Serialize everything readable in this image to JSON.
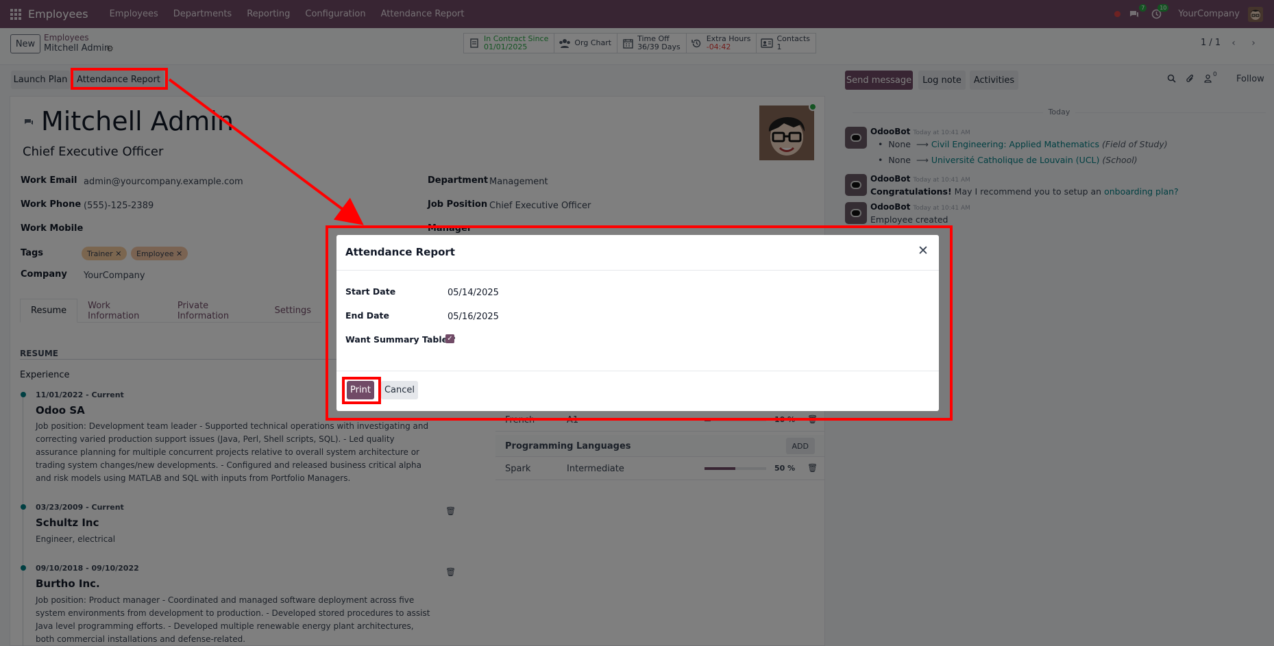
{
  "navbar": {
    "brand": "Employees",
    "menu": [
      "Employees",
      "Departments",
      "Reporting",
      "Configuration",
      "Attendance Report"
    ],
    "messages_badge": "7",
    "activities_badge": "10",
    "company": "YourCompany",
    "accent": "#714b67"
  },
  "control_panel": {
    "new_label": "New",
    "breadcrumb_parent": "Employees",
    "breadcrumb_current": "Mitchell Admin",
    "stats": [
      {
        "icon": "contract-icon",
        "line1": "In Contract Since",
        "line2": "01/01/2025"
      },
      {
        "icon": "org-chart-icon",
        "line1": "Org Chart",
        "line2": ""
      },
      {
        "icon": "calendar-icon",
        "line1": "Time Off",
        "line2": "36/39 Days"
      },
      {
        "icon": "history-icon",
        "line1": "Extra Hours",
        "line2": "-04:42"
      },
      {
        "icon": "contacts-icon",
        "line1": "Contacts",
        "line2": "1"
      }
    ],
    "pager": "1 / 1"
  },
  "actions": {
    "launch_plan": "Launch Plan",
    "attendance_report": "Attendance Report"
  },
  "employee": {
    "name": "Mitchell Admin",
    "job_title": "Chief Executive Officer",
    "fields_left": [
      {
        "label": "Work Email",
        "value": "admin@yourcompany.example.com"
      },
      {
        "label": "Work Phone",
        "value": "(555)-125-2389"
      },
      {
        "label": "Work Mobile",
        "value": ""
      },
      {
        "label": "Tags",
        "value": ""
      },
      {
        "label": "Company",
        "value": "YourCompany"
      }
    ],
    "fields_right": [
      {
        "label": "Department",
        "value": "Management"
      },
      {
        "label": "Job Position",
        "value": "Chief Executive Officer"
      },
      {
        "label": "Manager",
        "value": ""
      }
    ],
    "tags": [
      {
        "label": "Trainer",
        "color": "#f7cd9f"
      },
      {
        "label": "Employee",
        "color": "#f5c6a5"
      }
    ]
  },
  "tabs": [
    "Resume",
    "Work Information",
    "Private Information",
    "Settings"
  ],
  "resume": {
    "section": "RESUME",
    "subsection": "Experience",
    "entries": [
      {
        "date": "11/01/2022 - Current",
        "title": "Odoo SA",
        "desc": "Job position: Development team leader - Supported technical operations with investigating and correcting varied production support issues (Java, Perl, Shell scripts, SQL). - Led quality assurance planning for multiple concurrent projects relative to overall system architecture or trading system changes/new developments. - Configured and released business critical alpha and risk models using MATLAB and SQL with inputs from Portfolio Managers."
      },
      {
        "date": "03/23/2009 - Current",
        "title": "Schultz Inc",
        "desc": "Engineer, electrical"
      },
      {
        "date": "09/10/2018 - 09/10/2022",
        "title": "Burtho Inc.",
        "desc": "Job position: Product manager - Coordinated and managed software deployment across five system environments from development to production. - Developed stored procedures to assist Java level programming efforts. - Developed multiple renewable energy plant architectures, both commercial installations and defense-related."
      }
    ]
  },
  "skills": {
    "partial_row": {
      "name": "French",
      "level": "A1",
      "percent": "10 %",
      "progress": 0.1
    },
    "group": "Programming Languages",
    "add_label": "ADD",
    "rows": [
      {
        "name": "Spark",
        "level": "Intermediate",
        "percent": "50 %",
        "progress": 0.5
      }
    ]
  },
  "chatter": {
    "send_message": "Send message",
    "log_note": "Log note",
    "activities": "Activities",
    "followers_count": "0",
    "follow": "Follow",
    "today": "Today",
    "messages": [
      {
        "author": "OdooBot",
        "time": "Today at 10:41 AM"
      },
      {
        "author": "OdooBot",
        "time": "Today at 10:41 AM"
      },
      {
        "author": "OdooBot",
        "time": "Today at 10:41 AM"
      }
    ],
    "tracking": [
      {
        "old": "None",
        "new": "Civil Engineering: Applied Mathematics",
        "field": "(Field of Study)"
      },
      {
        "old": "None",
        "new": "Université Catholique de Louvain (UCL)",
        "field": "(School)"
      }
    ],
    "congrats_bold": "Congratulations!",
    "congrats_text": " May I recommend you to setup an ",
    "congrats_link": "onboarding plan?",
    "created": "Employee created"
  },
  "dialog": {
    "title": "Attendance Report",
    "start_label": "Start Date",
    "start_value": "05/14/2025",
    "end_label": "End Date",
    "end_value": "05/16/2025",
    "summary_label": "Want Summary Table ?",
    "summary_checked": true,
    "print_label": "Print",
    "cancel_label": "Cancel"
  }
}
